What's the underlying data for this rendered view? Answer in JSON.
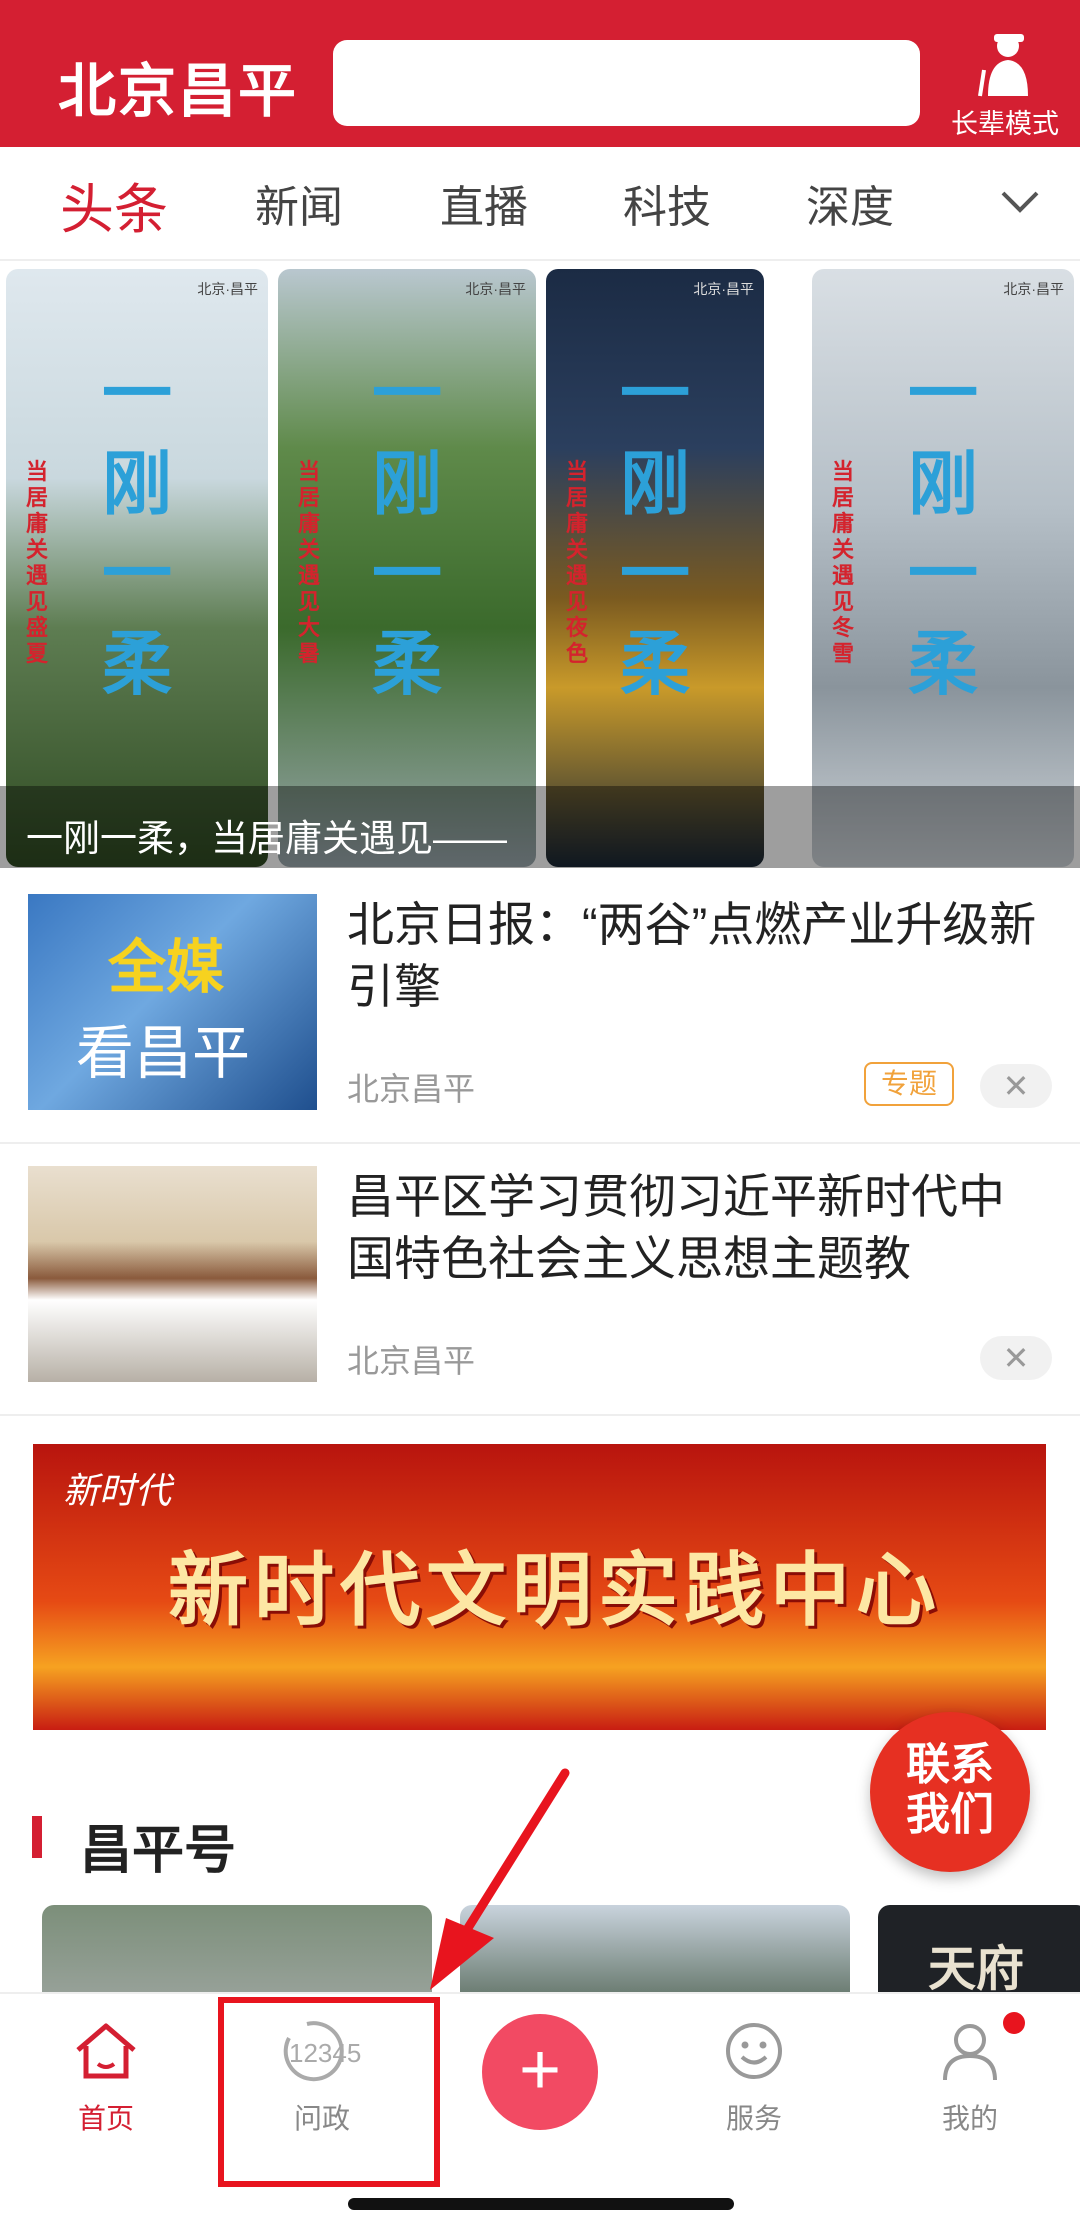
{
  "header": {
    "logo": "北京昌平",
    "search_placeholder": "",
    "elder_mode_label": "长辈模式"
  },
  "tabs": [
    {
      "label": "头条",
      "active": true
    },
    {
      "label": "新闻"
    },
    {
      "label": "直播"
    },
    {
      "label": "科技"
    },
    {
      "label": "深度"
    }
  ],
  "carousel": {
    "caption": "一刚一柔，当居庸关遇见——",
    "cards": [
      {
        "title": "一刚一柔",
        "subtitle": "当居庸关遇见盛夏",
        "tag": "北京·昌平"
      },
      {
        "title": "一刚一柔",
        "subtitle": "当居庸关遇见大暑",
        "tag": "北京·昌平"
      },
      {
        "title": "一刚一柔",
        "subtitle": "当居庸关遇见夜色",
        "tag": "北京·昌平"
      },
      {
        "title": "一刚一柔",
        "subtitle": "当居庸关遇见冬雪",
        "tag": "北京·昌平"
      }
    ]
  },
  "news": [
    {
      "thumb_text_1": "全媒",
      "thumb_text_2": "看昌平",
      "title": "北京日报：“两谷”点燃产业升级新引擎",
      "source": "北京昌平",
      "badge": "专题",
      "close": "✕"
    },
    {
      "title": "昌平区学习贯彻习近平新时代中国特色社会主义思想主题教",
      "source": "北京昌平",
      "close": "✕"
    }
  ],
  "banner": {
    "seal": "新时代",
    "text": "新时代文明实践中心"
  },
  "contact_button": {
    "line1": "联系",
    "line2": "我们"
  },
  "section": {
    "title": "昌平号"
  },
  "strip": {
    "card3_text": "天府"
  },
  "bottom_nav": [
    {
      "label": "首页",
      "icon": "home-icon",
      "active": true
    },
    {
      "label": "问政",
      "icon": "12345-icon",
      "icon_text": "12345"
    },
    {
      "label": "",
      "icon": "plus-icon",
      "icon_text": "+"
    },
    {
      "label": "服务",
      "icon": "smile-icon"
    },
    {
      "label": "我的",
      "icon": "user-icon"
    }
  ],
  "colors": {
    "brand": "#d41f32",
    "badge": "#f1a23b",
    "plus": "#f24a63"
  }
}
